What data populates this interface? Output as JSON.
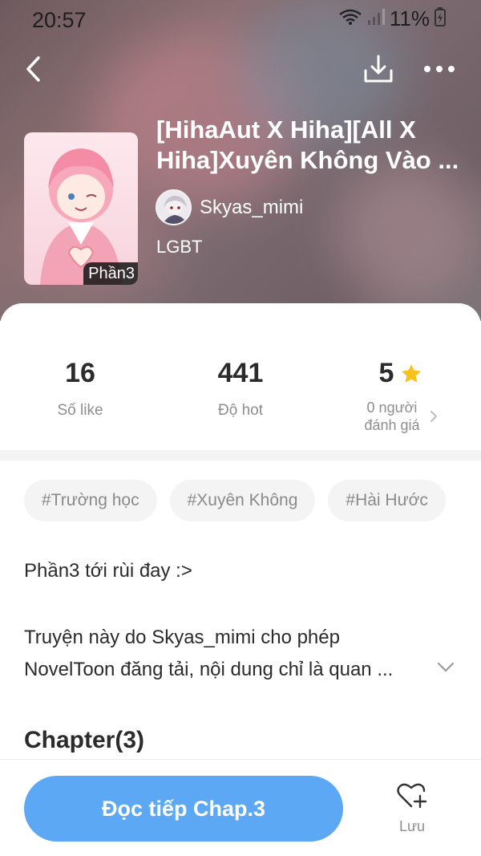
{
  "status_bar": {
    "time": "20:57",
    "battery": "11%"
  },
  "header": {
    "cover_badge": "Phần3",
    "title": "[HihaAut X Hiha][All X Hiha]Xuyên Không Vào ...",
    "author": "Skyas_mimi",
    "genre": "LGBT"
  },
  "stats": {
    "likes_value": "16",
    "likes_label": "Số like",
    "hot_value": "441",
    "hot_label": "Độ hot",
    "rating_value": "5",
    "rating_label_line1": "0 người",
    "rating_label_line2": "đánh giá"
  },
  "tags": [
    "#Trường học",
    "#Xuyên Không",
    "#Hài Hước"
  ],
  "intro": "Phần3 tới rùi đay :>",
  "description_line1": "Truyện này do Skyas_mimi cho phép",
  "description_line2": "NovelToon đăng tải, nội dung chỉ là quan ...",
  "chapters_title": "Chapter(3)",
  "bottom": {
    "read_button": "Đọc tiếp Chap.3",
    "save_label": "Lưu"
  },
  "colors": {
    "accent": "#5da8f5",
    "star": "#f8c21e"
  }
}
